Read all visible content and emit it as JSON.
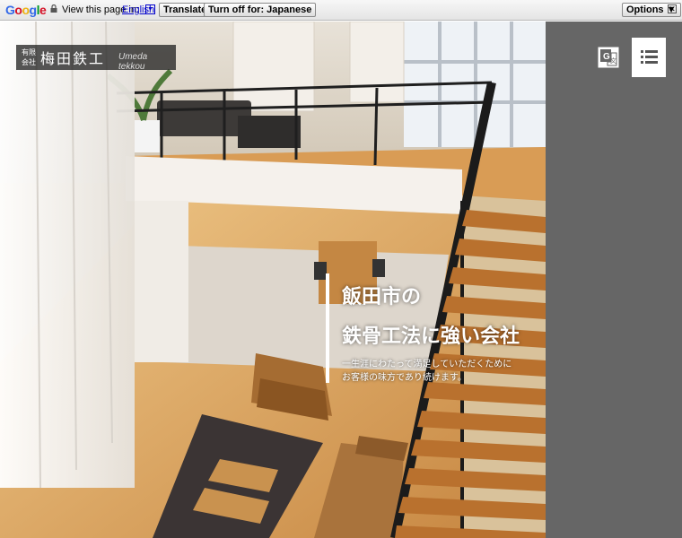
{
  "translate_bar": {
    "logo": "Google",
    "view_text": "View this page in:",
    "language": "English",
    "translate_label": "Translate",
    "turn_off_label": "Turn off for: Japanese",
    "options_label": "Options ▼",
    "close_glyph": "✕"
  },
  "site": {
    "logo_small": "有限会社",
    "logo_name": "梅田鉄工",
    "logo_romaji": "Umeda tekkou"
  },
  "hero": {
    "headline_line1": "飯田市の",
    "headline_line2": "鉄骨工法に強い会社",
    "sub_line1": "一生涯にわたって満足していただくために",
    "sub_line2": "お客様の味方であり続けます。"
  },
  "icons": {
    "translate": "google-translate-icon",
    "menu": "menu-icon"
  },
  "colors": {
    "side_panel": "#666666",
    "link": "#0000cc"
  }
}
